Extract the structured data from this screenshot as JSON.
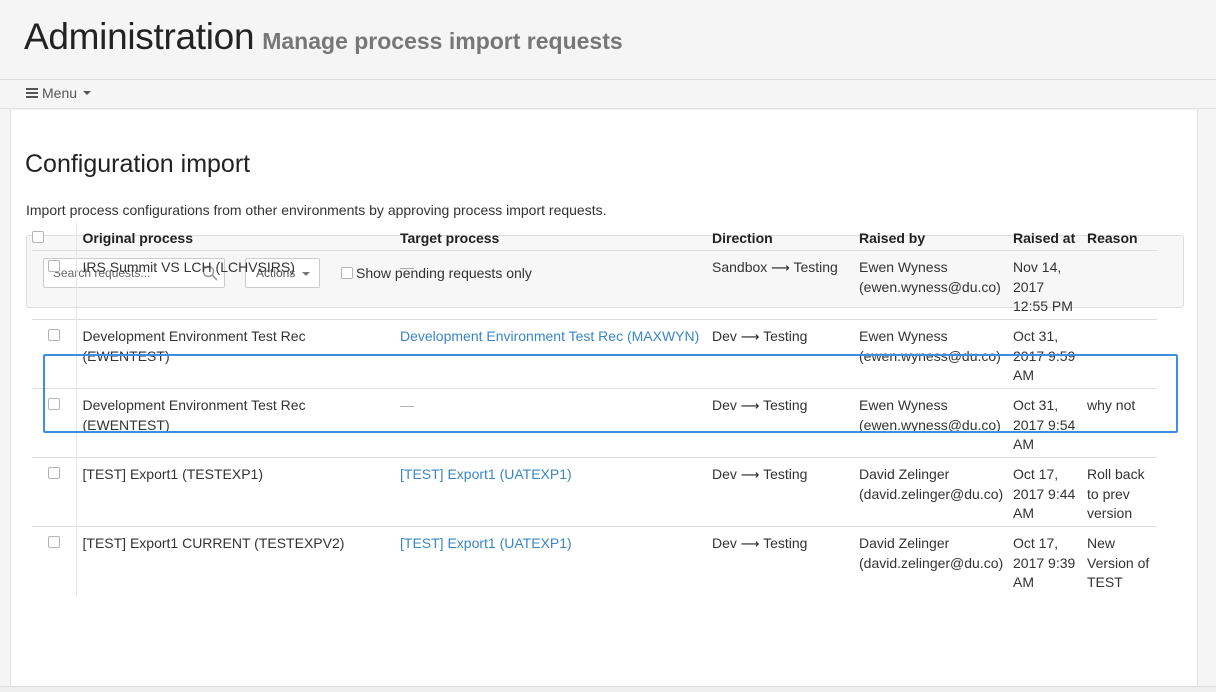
{
  "header": {
    "title": "Administration",
    "subtitle": "Manage process import requests"
  },
  "menu": {
    "label": "Menu"
  },
  "section": {
    "title": "Configuration import",
    "description": "Import process configurations from other environments by approving process import requests."
  },
  "toolbar": {
    "search_placeholder": "Search requests...",
    "actions_label": "Actions",
    "pending_label": "Show pending requests only"
  },
  "table": {
    "columns": {
      "original": "Original process",
      "target": "Target process",
      "direction": "Direction",
      "raised_by": "Raised by",
      "raised_at": "Raised at",
      "reason": "Reason"
    },
    "arrow": "⟶",
    "rows": [
      {
        "original": "IRS Summit VS LCH (LCHVSIRS)",
        "target": "—",
        "direction_from": "Sandbox",
        "direction_to": "Testing",
        "raised_by_name": "Ewen Wyness",
        "raised_by_email": "(ewen.wyness@du.co)",
        "raised_at": "Nov 14, 2017 12:55 PM",
        "reason": ""
      },
      {
        "original": "Development Environment Test Rec (EWENTEST)",
        "target": "Development Environment Test Rec (MAXWYN)",
        "direction_from": "Dev",
        "direction_to": "Testing",
        "raised_by_name": "Ewen Wyness",
        "raised_by_email": "(ewen.wyness@du.co)",
        "raised_at": "Oct 31, 2017 9:59 AM",
        "reason": ""
      },
      {
        "original": "Development Environment Test Rec (EWENTEST)",
        "target": "—",
        "direction_from": "Dev",
        "direction_to": "Testing",
        "raised_by_name": "Ewen Wyness",
        "raised_by_email": "(ewen.wyness@du.co)",
        "raised_at": "Oct 31, 2017 9:54 AM",
        "reason": "why not"
      },
      {
        "original": "[TEST] Export1 (TESTEXP1)",
        "target": "[TEST] Export1 (UATEXP1)",
        "direction_from": "Dev",
        "direction_to": "Testing",
        "raised_by_name": "David Zelinger",
        "raised_by_email": "(david.zelinger@du.co)",
        "raised_at": "Oct 17, 2017 9:44 AM",
        "reason": "Roll back to prev version"
      },
      {
        "original": "[TEST] Export1 CURRENT (TESTEXPV2)",
        "target": "[TEST] Export1 (UATEXP1)",
        "direction_from": "Dev",
        "direction_to": "Testing",
        "raised_by_name": "David Zelinger",
        "raised_by_email": "(david.zelinger@du.co)",
        "raised_at": "Oct 17, 2017 9:39 AM",
        "reason": "New Version of TEST"
      }
    ]
  }
}
